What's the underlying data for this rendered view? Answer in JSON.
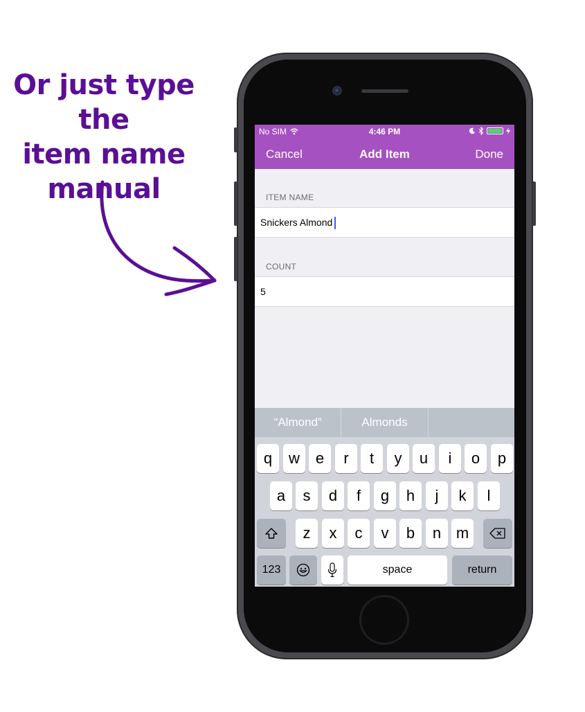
{
  "caption": {
    "line1": "Or just type the",
    "line2": "item name",
    "line3": "manual"
  },
  "colors": {
    "accent": "#a651c1",
    "caption": "#5a0f96",
    "battery": "#4cd964",
    "background": "#efeff4"
  },
  "statusbar": {
    "carrier": "No SIM",
    "wifi_icon": "wifi-icon",
    "time": "4:46 PM",
    "moon_icon": "moon-icon",
    "bluetooth_icon": "bluetooth-icon",
    "battery_icon": "battery-icon"
  },
  "navbar": {
    "cancel": "Cancel",
    "title": "Add Item",
    "done": "Done"
  },
  "form": {
    "item_name_header": "ITEM NAME",
    "item_name_value": "Snickers Almond",
    "count_header": "COUNT",
    "count_value": "5"
  },
  "keyboard": {
    "suggestions": [
      "“Almond”",
      "Almonds",
      ""
    ],
    "row1": [
      "q",
      "w",
      "e",
      "r",
      "t",
      "y",
      "u",
      "i",
      "o",
      "p"
    ],
    "row2": [
      "a",
      "s",
      "d",
      "f",
      "g",
      "h",
      "j",
      "k",
      "l"
    ],
    "row3": [
      "z",
      "x",
      "c",
      "v",
      "b",
      "n",
      "m"
    ],
    "shift_icon": "shift-icon",
    "delete_icon": "delete-icon",
    "numbers": "123",
    "emoji_icon": "emoji-icon",
    "mic_icon": "microphone-icon",
    "space": "space",
    "return": "return"
  }
}
